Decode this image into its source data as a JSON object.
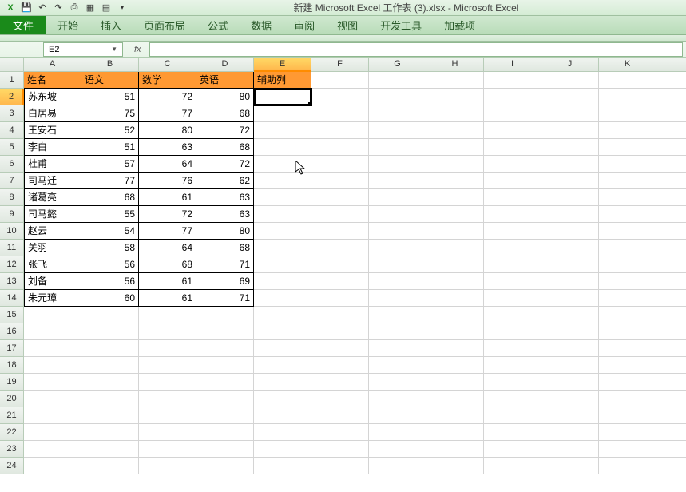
{
  "title": "新建 Microsoft Excel 工作表 (3).xlsx  -  Microsoft Excel",
  "qa": [
    "excel-icon",
    "save",
    "undo",
    "redo",
    "print",
    "new",
    "open",
    "more"
  ],
  "tabs": {
    "file": "文件",
    "home": "开始",
    "insert": "插入",
    "layout": "页面布局",
    "formula": "公式",
    "data": "数据",
    "review": "审阅",
    "view": "视图",
    "dev": "开发工具",
    "addin": "加载项"
  },
  "namebox": "E2",
  "fx_label": "fx",
  "formula_value": "",
  "cols": [
    "A",
    "B",
    "C",
    "D",
    "E",
    "F",
    "G",
    "H",
    "I",
    "J",
    "K",
    ""
  ],
  "selected_col": "E",
  "selected_row": 2,
  "row_count": 24,
  "headers": {
    "A": "姓名",
    "B": "语文",
    "C": "数学",
    "D": "英语",
    "E": "辅助列"
  },
  "rows": [
    {
      "name": "苏东坡",
      "b": 51,
      "c": 72,
      "d": 80
    },
    {
      "name": "白居易",
      "b": 75,
      "c": 77,
      "d": 68
    },
    {
      "name": "王安石",
      "b": 52,
      "c": 80,
      "d": 72
    },
    {
      "name": "李白",
      "b": 51,
      "c": 63,
      "d": 68
    },
    {
      "name": "杜甫",
      "b": 57,
      "c": 64,
      "d": 72
    },
    {
      "name": "司马迁",
      "b": 77,
      "c": 76,
      "d": 62
    },
    {
      "name": "诸葛亮",
      "b": 68,
      "c": 61,
      "d": 63
    },
    {
      "name": "司马懿",
      "b": 55,
      "c": 72,
      "d": 63
    },
    {
      "name": "赵云",
      "b": 54,
      "c": 77,
      "d": 80
    },
    {
      "name": "关羽",
      "b": 58,
      "c": 64,
      "d": 68
    },
    {
      "name": "张飞",
      "b": 56,
      "c": 68,
      "d": 71
    },
    {
      "name": "刘备",
      "b": 56,
      "c": 61,
      "d": 69
    },
    {
      "name": "朱元璋",
      "b": 60,
      "c": 61,
      "d": 71
    }
  ]
}
